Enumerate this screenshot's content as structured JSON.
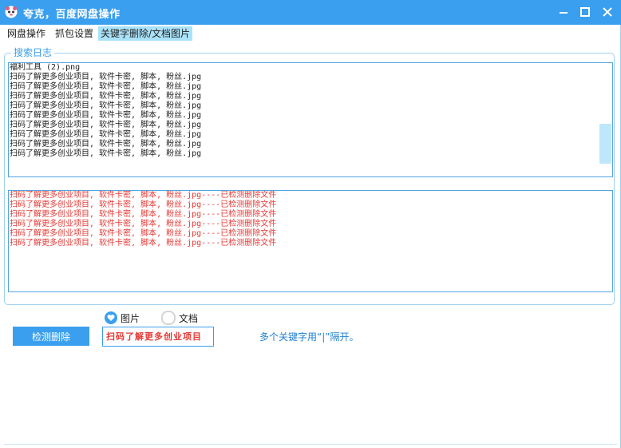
{
  "window": {
    "title": "夸克，百度网盘操作",
    "icon": "panda-avatar-icon",
    "controls": [
      "minimize-icon",
      "maximize-icon",
      "close-icon"
    ]
  },
  "tabs": [
    {
      "label": "网盘操作",
      "active": false
    },
    {
      "label": "抓包设置",
      "active": false
    },
    {
      "label": "关键字删除/文档图片",
      "active": true
    }
  ],
  "log_group": {
    "legend": "搜索日志",
    "search_lines": [
      "福利工具 (2).png",
      "扫码了解更多创业项目, 软件卡密, 脚本, 粉丝.jpg",
      "扫码了解更多创业项目, 软件卡密, 脚本, 粉丝.jpg",
      "扫码了解更多创业项目, 软件卡密, 脚本, 粉丝.jpg",
      "扫码了解更多创业项目, 软件卡密, 脚本, 粉丝.jpg",
      "扫码了解更多创业项目, 软件卡密, 脚本, 粉丝.jpg",
      "扫码了解更多创业项目, 软件卡密, 脚本, 粉丝.jpg",
      "扫码了解更多创业项目, 软件卡密, 脚本, 粉丝.jpg",
      "扫码了解更多创业项目, 软件卡密, 脚本, 粉丝.jpg",
      "扫码了解更多创业项目, 软件卡密, 脚本, 粉丝.jpg"
    ],
    "deleted_lines": [
      "扫码了解更多创业项目, 软件卡密, 脚本, 粉丝.jpg----已检测删除文件",
      "扫码了解更多创业项目, 软件卡密, 脚本, 粉丝.jpg----已检测删除文件",
      "扫码了解更多创业项目, 软件卡密, 脚本, 粉丝.jpg----已检测删除文件",
      "扫码了解更多创业项目, 软件卡密, 脚本, 粉丝.jpg----已检测删除文件",
      "扫码了解更多创业项目, 软件卡密, 脚本, 粉丝.jpg----已检测删除文件",
      "扫码了解更多创业项目, 软件卡密, 脚本, 粉丝.jpg----已检测删除文件"
    ]
  },
  "controls": {
    "detect_button": "检测删除",
    "radio_image": {
      "label": "图片",
      "selected": true
    },
    "radio_doc": {
      "label": "文档",
      "selected": false
    },
    "keyword_value": "扫码了解更多创业项目",
    "hint": "多个关键字用“|”隔开。"
  },
  "colors": {
    "accent": "#3a9fef",
    "active_tab": "#a9e2f9",
    "deleted_text": "#e53935"
  }
}
